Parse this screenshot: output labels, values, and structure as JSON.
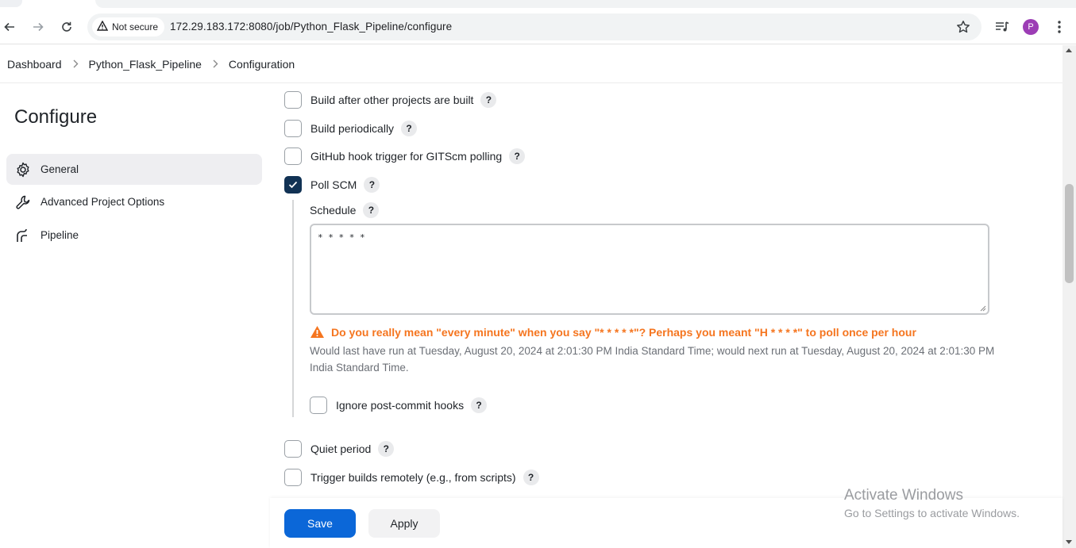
{
  "browser": {
    "security_label": "Not secure",
    "url": "172.29.183.172:8080/job/Python_Flask_Pipeline/configure",
    "profile_initial": "P"
  },
  "breadcrumb": {
    "items": [
      "Dashboard",
      "Python_Flask_Pipeline",
      "Configuration"
    ]
  },
  "sidebar": {
    "title": "Configure",
    "items": [
      {
        "label": "General",
        "icon": "gear-icon",
        "active": true
      },
      {
        "label": "Advanced Project Options",
        "icon": "wrench-icon",
        "active": false
      },
      {
        "label": "Pipeline",
        "icon": "pipeline-icon",
        "active": false
      }
    ]
  },
  "triggers": {
    "build_after": {
      "label": "Build after other projects are built",
      "checked": false
    },
    "build_periodically": {
      "label": "Build periodically",
      "checked": false
    },
    "github_hook": {
      "label": "GitHub hook trigger for GITScm polling",
      "checked": false
    },
    "poll_scm": {
      "label": "Poll SCM",
      "checked": true
    },
    "schedule": {
      "label": "Schedule",
      "value": "* * * * *",
      "warning": "Do you really mean \"every minute\" when you say \"* * * * *\"? Perhaps you meant \"H * * * *\" to poll once per hour",
      "run_info": "Would last have run at Tuesday, August 20, 2024 at 2:01:30 PM India Standard Time; would next run at Tuesday, August 20, 2024 at 2:01:30 PM India Standard Time."
    },
    "ignore_post_commit": {
      "label": "Ignore post-commit hooks",
      "checked": false
    },
    "quiet_period": {
      "label": "Quiet period",
      "checked": false
    },
    "trigger_remotely": {
      "label": "Trigger builds remotely (e.g., from scripts)",
      "checked": false
    },
    "help_glyph": "?"
  },
  "actions": {
    "save_label": "Save",
    "apply_label": "Apply"
  },
  "watermark": {
    "line1": "Activate Windows",
    "line2": "Go to Settings to activate Windows."
  },
  "colors": {
    "save_button": "#0b67d8",
    "checkbox_checked": "#113254",
    "warning": "#f5751f"
  }
}
